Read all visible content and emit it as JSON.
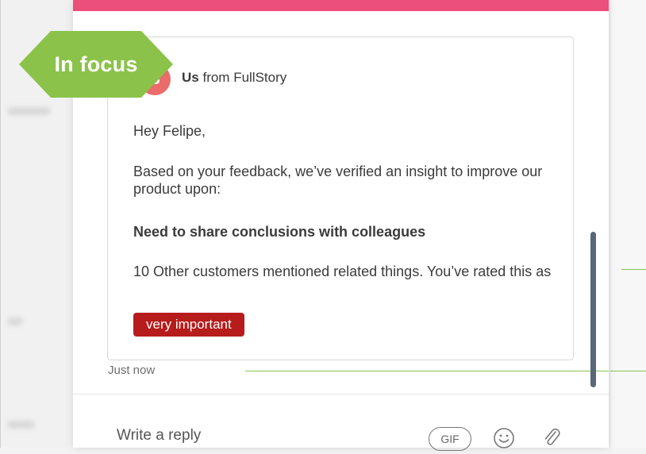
{
  "focus_tag": {
    "label": "In focus"
  },
  "message": {
    "avatar_initial": "S",
    "sender_name": "Us",
    "sender_suffix": "from FullStory",
    "greeting": "Hey Felipe,",
    "intro": "Based on your feedback, we’ve verified an insight to improve our product upon:",
    "insight": "Need to share conclusions with colleagues",
    "mentions": "10 Other customers mentioned related things. You’ve rated this as",
    "rating_badge": "very important",
    "timestamp": "Just now"
  },
  "composer": {
    "placeholder": "Write a reply",
    "gif_label": "GIF"
  },
  "icons": {
    "emoji": "smiley-icon",
    "attach": "paperclip-icon"
  },
  "colors": {
    "accent_pink": "#ec4f79",
    "focus_green": "#8bc34a",
    "badge_red": "#b71c1c",
    "scrollbar": "#56687a"
  }
}
